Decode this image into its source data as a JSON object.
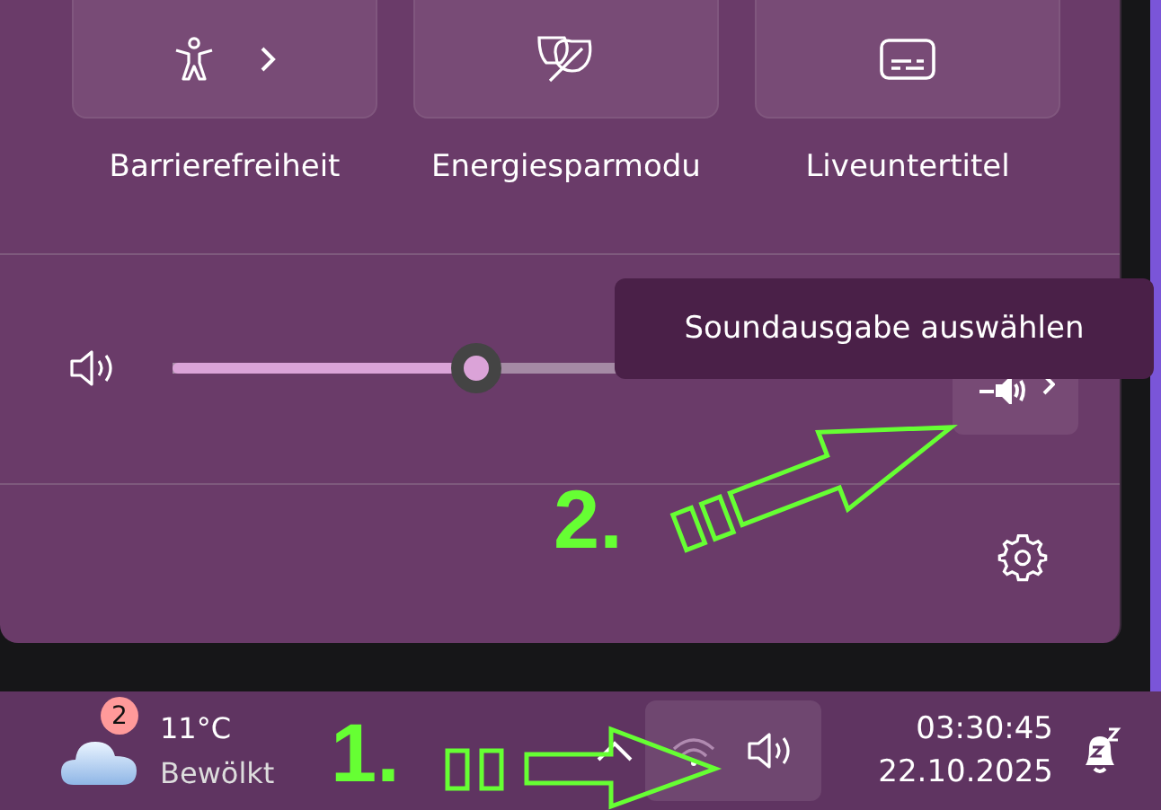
{
  "quick_tiles": [
    {
      "label": "Barrierefreiheit",
      "kind": "accessibility",
      "expandable": true
    },
    {
      "label": "Energiesparmodu",
      "kind": "leaf",
      "expandable": false
    },
    {
      "label": "Liveuntertitel",
      "kind": "captions",
      "expandable": false
    }
  ],
  "volume": {
    "level": 0.4
  },
  "tooltip": {
    "text": "Soundausgabe auswählen"
  },
  "taskbar": {
    "weather": {
      "badge": "2",
      "temperature": "11°C",
      "condition": "Bewölkt"
    },
    "clock": {
      "time": "03:30:45",
      "date": "22.10.2025"
    }
  },
  "annotations": [
    {
      "label": "1."
    },
    {
      "label": "2."
    }
  ]
}
